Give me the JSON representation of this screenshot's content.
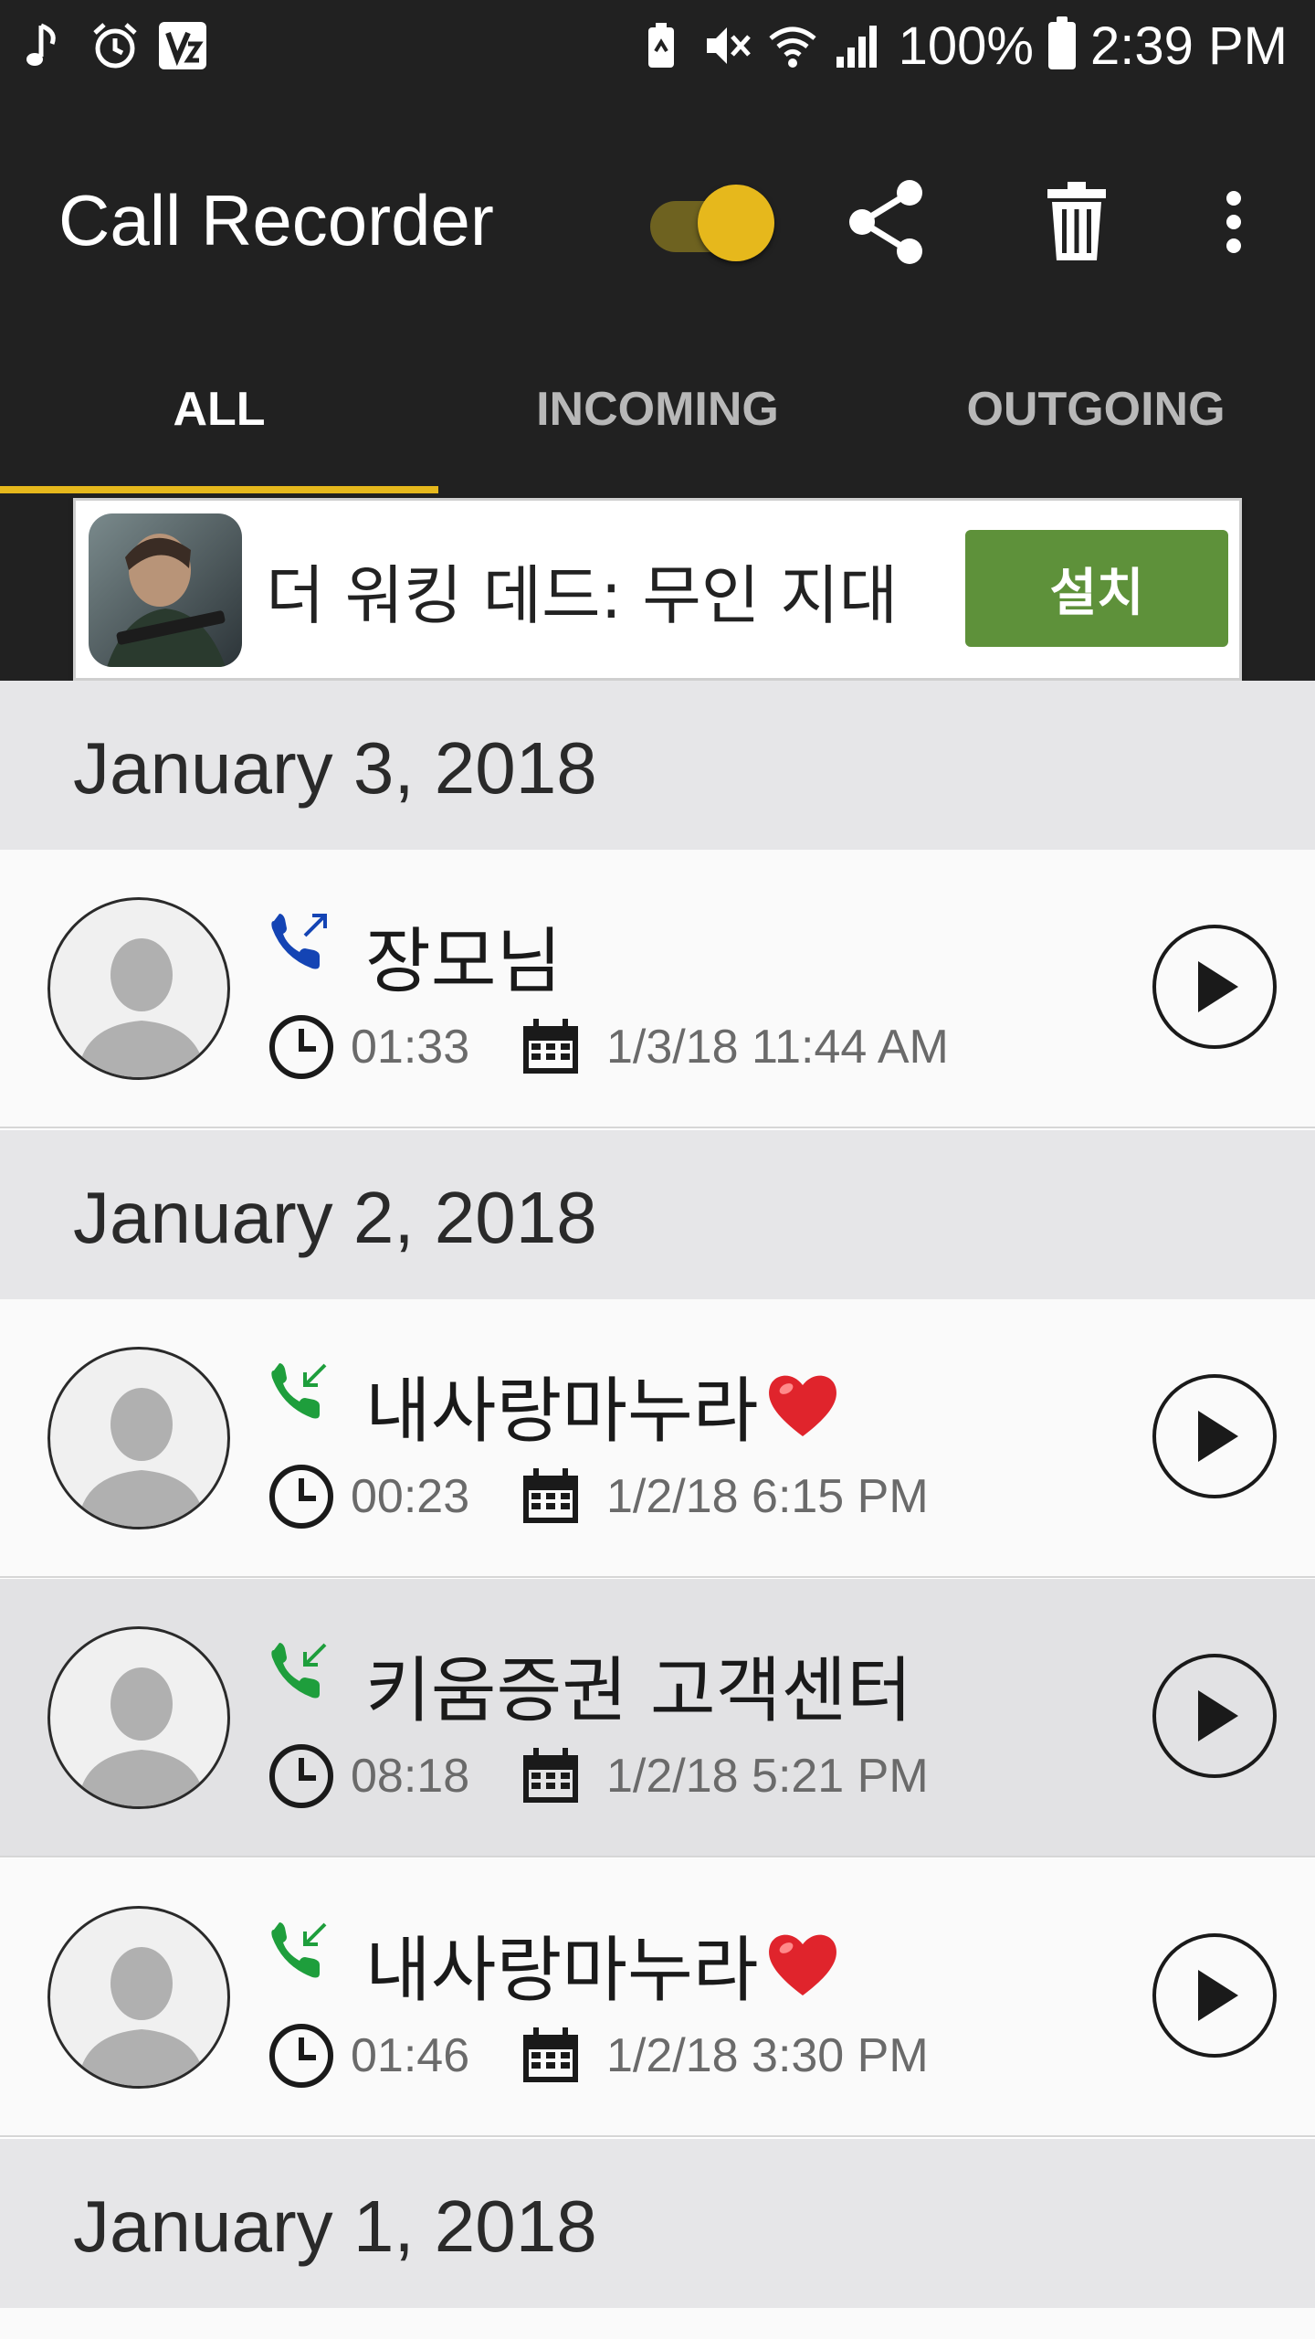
{
  "status_bar": {
    "battery_percent": "100%",
    "time": "2:39 PM",
    "left_icons": [
      "music-note-icon",
      "alarm-clock-icon",
      "v3-app-icon"
    ],
    "right_icons": [
      "battery-saver-icon",
      "mute-icon",
      "wifi-icon",
      "signal-icon",
      "battery-icon"
    ]
  },
  "toolbar": {
    "title": "Call Recorder",
    "recording_enabled": true,
    "actions": [
      "share-icon",
      "trash-icon",
      "more-vert-icon"
    ]
  },
  "tabs": [
    {
      "label": "ALL",
      "active": true
    },
    {
      "label": "INCOMING",
      "active": false
    },
    {
      "label": "OUTGOING",
      "active": false
    }
  ],
  "ad": {
    "title": "더 워킹 데드: 무인 지대",
    "install_label": "설치"
  },
  "groups": [
    {
      "date": "January 3, 2018",
      "calls": [
        {
          "name": "장모님",
          "has_heart": false,
          "direction": "outgoing",
          "duration": "01:33",
          "datetime": "1/3/18 11:44 AM",
          "selected": false
        }
      ]
    },
    {
      "date": "January 2, 2018",
      "calls": [
        {
          "name": "내사랑마누라",
          "has_heart": true,
          "direction": "incoming",
          "duration": "00:23",
          "datetime": "1/2/18 6:15 PM",
          "selected": false
        },
        {
          "name": "키움증권 고객센터",
          "has_heart": false,
          "direction": "incoming",
          "duration": "08:18",
          "datetime": "1/2/18 5:21 PM",
          "selected": true
        },
        {
          "name": "내사랑마누라",
          "has_heart": true,
          "direction": "incoming",
          "duration": "01:46",
          "datetime": "1/2/18 3:30 PM",
          "selected": false
        }
      ]
    },
    {
      "date": "January 1, 2018",
      "calls": []
    }
  ],
  "colors": {
    "toolbar_bg": "#212121",
    "accent_yellow": "#e6b81c",
    "install_green": "#5e913a",
    "incoming_green": "#1e9e3c",
    "outgoing_blue": "#1444b4",
    "date_header_bg": "#e6e6e8"
  }
}
